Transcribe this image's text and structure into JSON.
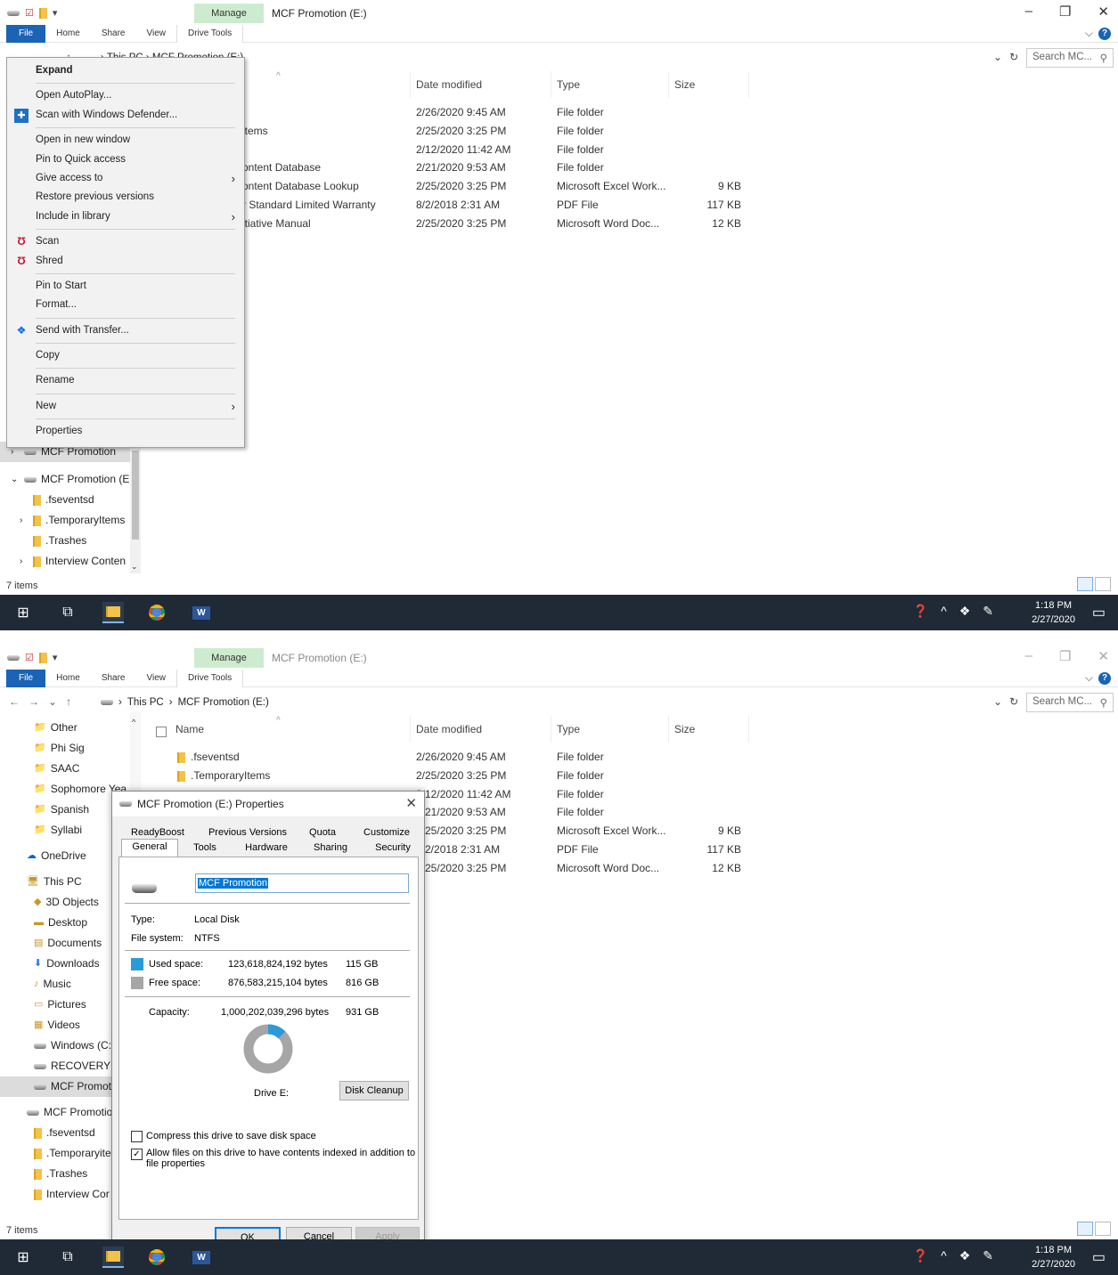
{
  "window1": {
    "title": "MCF Promotion (E:)",
    "manage_tab": "Manage",
    "ribbon_tabs": [
      "File",
      "Home",
      "Share",
      "View",
      "Drive Tools"
    ],
    "address": {
      "crumbs": [
        "This PC",
        "MCF Promotion (E:)"
      ],
      "visible_text": "› This PC › MCF Promotion (E:)"
    },
    "search_placeholder": "Search MC...",
    "columns": {
      "name": "Name",
      "date": "Date modified",
      "type": "Type",
      "size": "Size"
    },
    "rows": [
      {
        "name": "",
        "date": "2/26/2020 9:45 AM",
        "type": "File folder",
        "size": ""
      },
      {
        "name": "ltems",
        "date": "2/25/2020 3:25 PM",
        "type": "File folder",
        "size": ""
      },
      {
        "name": "",
        "date": "2/12/2020 11:42 AM",
        "type": "File folder",
        "size": ""
      },
      {
        "name": "ontent Database",
        "date": "2/21/2020 9:53 AM",
        "type": "File folder",
        "size": ""
      },
      {
        "name": "ontent Database Lookup",
        "date": "2/25/2020 3:25 PM",
        "type": "Microsoft Excel Work...",
        "size": "9 KB"
      },
      {
        "name": "r Standard Limited Warranty",
        "date": "8/2/2018 2:31 AM",
        "type": "PDF File",
        "size": "117 KB"
      },
      {
        "name": "itiative Manual",
        "date": "2/25/2020 3:25 PM",
        "type": "Microsoft Word Doc...",
        "size": "12 KB"
      }
    ],
    "nav": [
      {
        "label": "MCF Promotion",
        "icon": "drive-icon",
        "arrow": ">"
      },
      {
        "label": "MCF Promotion (E",
        "icon": "drive-icon",
        "arrow": "v"
      },
      {
        "label": ".fseventsd",
        "icon": "folder-icon",
        "arrow": ""
      },
      {
        "label": ".TemporaryItems",
        "icon": "folder-icon",
        "arrow": ">"
      },
      {
        "label": ".Trashes",
        "icon": "folder-icon",
        "arrow": ""
      },
      {
        "label": "Interview Conten",
        "icon": "folder-icon",
        "arrow": ">"
      }
    ],
    "status": "7 items",
    "context_menu": [
      {
        "label": "Expand",
        "bold": true
      },
      {
        "sep": true
      },
      {
        "label": "Open AutoPlay..."
      },
      {
        "label": "Scan with Windows Defender...",
        "icon": "defender-shield-icon"
      },
      {
        "sep": true
      },
      {
        "label": "Open in new window"
      },
      {
        "label": "Pin to Quick access"
      },
      {
        "label": "Give access to",
        "submenu": true
      },
      {
        "label": "Restore previous versions"
      },
      {
        "label": "Include in library",
        "submenu": true
      },
      {
        "sep": true
      },
      {
        "label": "Scan",
        "icon": "mcafee-icon"
      },
      {
        "label": "Shred",
        "icon": "mcafee-icon"
      },
      {
        "sep": true
      },
      {
        "label": "Pin to Start"
      },
      {
        "label": "Format..."
      },
      {
        "sep": true
      },
      {
        "label": "Send with Transfer...",
        "icon": "dropbox-icon"
      },
      {
        "sep": true
      },
      {
        "label": "Copy"
      },
      {
        "sep": true
      },
      {
        "label": "Rename"
      },
      {
        "sep": true
      },
      {
        "label": "New",
        "submenu": true
      },
      {
        "sep": true
      },
      {
        "label": "Properties"
      }
    ]
  },
  "window2": {
    "title": "MCF Promotion (E:)",
    "manage_tab": "Manage",
    "ribbon_tabs": [
      "File",
      "Home",
      "Share",
      "View",
      "Drive Tools"
    ],
    "address": {
      "crumbs": [
        "This PC",
        "MCF Promotion (E:)"
      ],
      "visible_text": "This PC > MCF Promotion (E:)"
    },
    "search_placeholder": "Search MC...",
    "columns": {
      "name": "Name",
      "date": "Date modified",
      "type": "Type",
      "size": "Size"
    },
    "rows": [
      {
        "name": ".fseventsd",
        "date": "2/26/2020 9:45 AM",
        "type": "File folder",
        "size": ""
      },
      {
        "name": ".TemporaryItems",
        "date": "2/25/2020 3:25 PM",
        "type": "File folder",
        "size": ""
      },
      {
        "name": "",
        "date": "2/12/2020 11:42 AM",
        "type": "File folder",
        "size": ""
      },
      {
        "name": "",
        "date": "2/21/2020 9:53 AM",
        "type": "File folder",
        "size": ""
      },
      {
        "name": "",
        "date": "2/25/2020 3:25 PM",
        "type": "Microsoft Excel Work...",
        "size": "9 KB"
      },
      {
        "name": "",
        "date": "8/2/2018 2:31 AM",
        "type": "PDF File",
        "size": "117 KB"
      },
      {
        "name": "",
        "date": "2/25/2020 3:25 PM",
        "type": "Microsoft Word Doc...",
        "size": "12 KB"
      }
    ],
    "nav": [
      {
        "label": "Other",
        "icon": "user-folder-icon"
      },
      {
        "label": "Phi Sig",
        "icon": "user-folder-icon"
      },
      {
        "label": "SAAC",
        "icon": "user-folder-icon"
      },
      {
        "label": "Sophomore Yea",
        "icon": "user-folder-icon"
      },
      {
        "label": "Spanish",
        "icon": "user-folder-icon"
      },
      {
        "label": "Syllabi",
        "icon": "user-folder-icon"
      },
      {
        "label": "OneDrive",
        "icon": "cloud-icon"
      },
      {
        "label": "This PC",
        "icon": "pc-icon"
      },
      {
        "label": "3D Objects",
        "icon": "cube-icon"
      },
      {
        "label": "Desktop",
        "icon": "desktop-icon"
      },
      {
        "label": "Documents",
        "icon": "document-icon"
      },
      {
        "label": "Downloads",
        "icon": "download-icon"
      },
      {
        "label": "Music",
        "icon": "music-icon"
      },
      {
        "label": "Pictures",
        "icon": "pictures-icon"
      },
      {
        "label": "Videos",
        "icon": "video-icon"
      },
      {
        "label": "Windows (C:)",
        "icon": "drive-icon"
      },
      {
        "label": "RECOVERY (D",
        "icon": "drive-icon"
      },
      {
        "label": "MCF Promoti",
        "icon": "drive-icon"
      },
      {
        "label": "MCF Promotio",
        "icon": "drive-icon"
      },
      {
        "label": ".fseventsd",
        "icon": "folder-icon"
      },
      {
        "label": ".Temporaryite",
        "icon": "folder-icon"
      },
      {
        "label": ".Trashes",
        "icon": "folder-icon"
      },
      {
        "label": "Interview Cor",
        "icon": "folder-icon"
      }
    ],
    "status": "7 items",
    "dialog": {
      "title": "MCF Promotion (E:) Properties",
      "tabs_back": [
        "ReadyBoost",
        "Previous Versions",
        "Quota",
        "Customize"
      ],
      "tabs_front": [
        "General",
        "Tools",
        "Hardware",
        "Sharing",
        "Security"
      ],
      "name_value": "MCF Promotion",
      "type_label": "Type:",
      "type_value": "Local Disk",
      "fs_label": "File system:",
      "fs_value": "NTFS",
      "used_label": "Used space:",
      "used_bytes": "123,618,824,192 bytes",
      "used_gb": "115 GB",
      "free_label": "Free space:",
      "free_bytes": "876,583,215,104 bytes",
      "free_gb": "816 GB",
      "cap_label": "Capacity:",
      "cap_bytes": "1,000,202,039,296 bytes",
      "cap_gb": "931 GB",
      "used_fraction": 0.1236,
      "used_color": "#2b9ad9",
      "free_color": "#a6a6a6",
      "drive_label": "Drive E:",
      "cleanup": "Disk Cleanup",
      "compress": "Compress this drive to save disk space",
      "compress_checked": false,
      "index1": "Allow files on this drive to have contents indexed in addition to",
      "index2": "file properties",
      "index_checked": true,
      "ok": "OK",
      "cancel": "Cancel",
      "apply": "Apply"
    }
  },
  "taskbar": {
    "time": "1:18 PM",
    "date": "2/27/2020"
  }
}
